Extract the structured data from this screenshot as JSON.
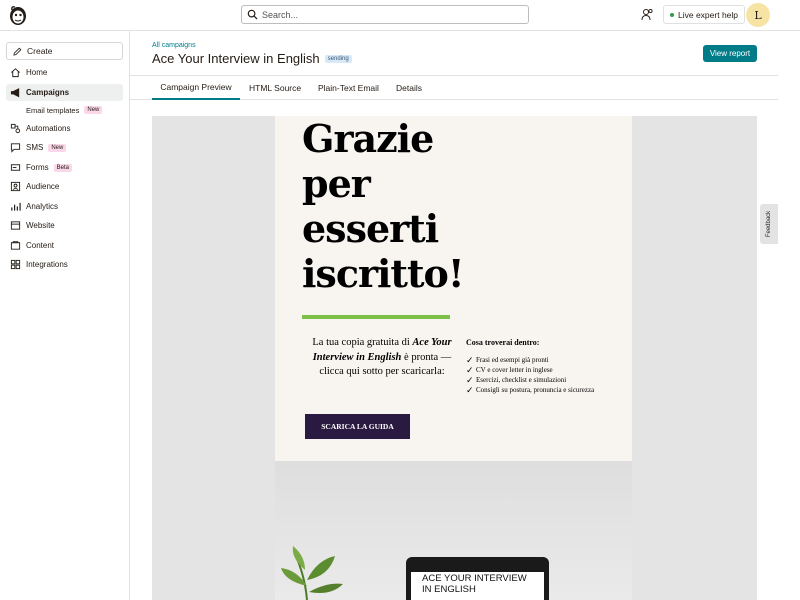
{
  "topbar": {
    "logo_icon": "mailchimp-logo-icon",
    "search_placeholder": "Search...",
    "team_icon": "people-icon",
    "expert_help": "Live expert help",
    "avatar_initial": "L"
  },
  "sidebar": {
    "create": "Create",
    "items": [
      {
        "label": "Home",
        "icon": "home-icon"
      },
      {
        "label": "Campaigns",
        "icon": "megaphone-icon",
        "active": true
      },
      {
        "label": "Email templates",
        "badge": "New",
        "sub": true
      },
      {
        "label": "Automations",
        "icon": "automations-icon"
      },
      {
        "label": "SMS",
        "icon": "sms-icon",
        "badge": "New"
      },
      {
        "label": "Forms",
        "icon": "forms-icon",
        "badge": "Beta"
      },
      {
        "label": "Audience",
        "icon": "audience-icon"
      },
      {
        "label": "Analytics",
        "icon": "analytics-icon"
      },
      {
        "label": "Website",
        "icon": "website-icon"
      },
      {
        "label": "Content",
        "icon": "content-icon"
      },
      {
        "label": "Integrations",
        "icon": "integrations-icon"
      }
    ]
  },
  "header": {
    "breadcrumb": "All campaigns",
    "title": "Ace Your Interview in English",
    "status": "sending",
    "view_report": "View report"
  },
  "tabs": [
    "Campaign Preview",
    "HTML Source",
    "Plain-Text Email",
    "Details"
  ],
  "email": {
    "headline": [
      "Grazie",
      "per",
      "esserti",
      "iscritto!"
    ],
    "intro_before": "La tua copia gratuita di",
    "intro_title": "Ace Your Interview in English",
    "intro_after": "è pronta — clicca qui sotto per scaricarla:",
    "cta": "SCARICA LA GUIDA",
    "inside_title": "Cosa troverai dentro:",
    "checklist": [
      "Frasi ed esempi già pronti",
      "CV e cover letter in inglese",
      "Esercizi, checklist e simulazioni",
      "Consigli su postura, pronuncia e sicurezza"
    ],
    "tablet_text": "ACE YOUR INTERVIEW IN ENGLISH"
  },
  "feedback": "Feedback",
  "colors": {
    "accent": "#007c89",
    "cta": "#2a1940",
    "green_bar": "#7cc047"
  }
}
